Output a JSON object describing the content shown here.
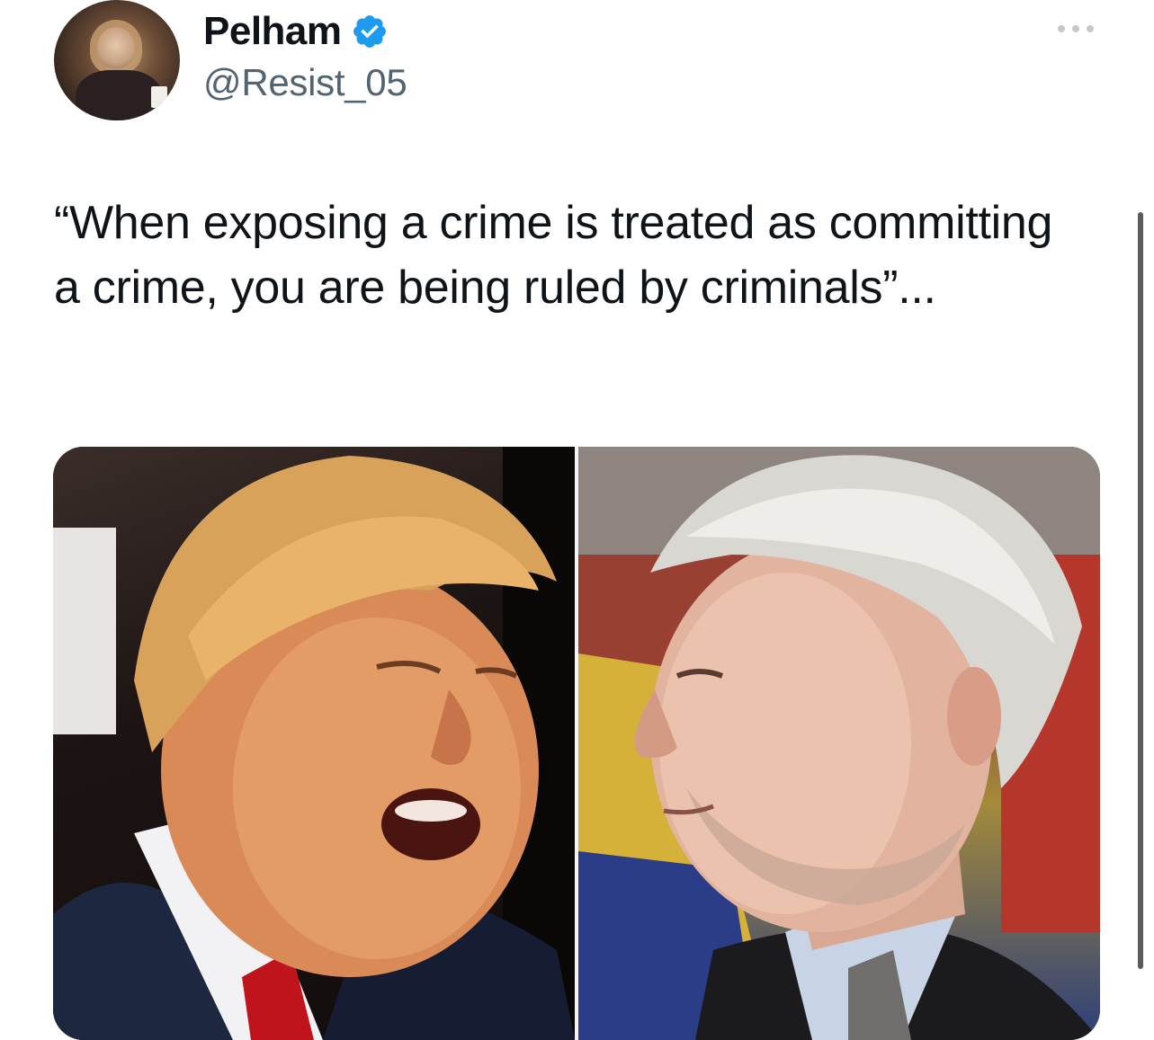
{
  "tweet": {
    "author": {
      "display_name": "Pelham",
      "handle": "@Resist_05",
      "verified": true,
      "verified_color": "#1d9bf0",
      "avatar_icon": "profile-photo"
    },
    "text": "“When exposing a crime is treated as committing a crime, you are being ruled by criminals”...",
    "media": {
      "layout": "side-by-side photo collage",
      "left_image": "photo-man-shouting",
      "right_image": "photo-man-profile"
    },
    "menu_icon": "more-options-icon"
  }
}
